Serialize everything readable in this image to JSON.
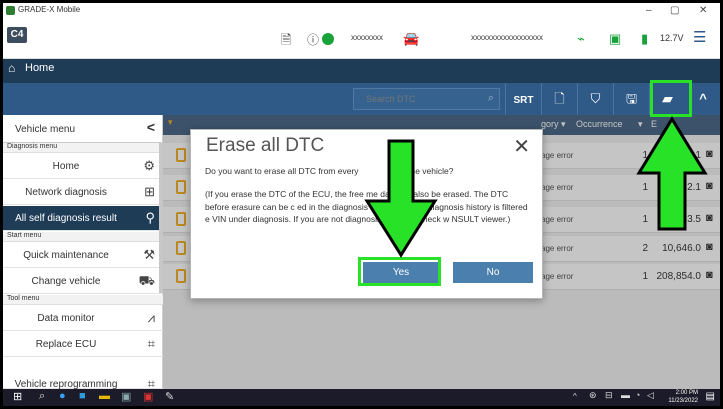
{
  "window": {
    "title": "GRADE-X Mobile",
    "minimize": "–",
    "maximize": "▢",
    "close": "✕"
  },
  "toolbar": {
    "logo": "C4",
    "masked_1": "xxxxxxxx",
    "masked_2": "xxxxxxxxxxxxxxxxxx",
    "voltage": "12.7V",
    "icons": [
      "page-icon",
      "power-status-icon",
      "car-icon",
      "signal-icon",
      "battery-icon",
      "hamburger-menu-icon"
    ]
  },
  "home": {
    "label": "Home"
  },
  "actions": {
    "search_placeholder": "Search DTC",
    "srt_label": "SRT"
  },
  "left_menu": {
    "title": "Vehicle menu",
    "sections": [
      {
        "header": "Diagnosis menu"
      },
      {
        "header": "Start menu"
      },
      {
        "header": "Tool menu"
      }
    ],
    "items": [
      {
        "label": "Home",
        "icon": "gear-icon"
      },
      {
        "label": "Network diagnosis",
        "icon": "network-icon"
      },
      {
        "label": "All self diagnosis result",
        "icon": "car-search-icon",
        "active": true
      },
      {
        "label": "Quick maintenance",
        "icon": "wrench-icon"
      },
      {
        "label": "Change vehicle",
        "icon": "car-icon"
      },
      {
        "label": "Data monitor",
        "icon": "monitor-icon"
      },
      {
        "label": "Replace ECU",
        "icon": "chip-icon"
      },
      {
        "label": "Vehicle reprogramming",
        "icon": "chip-icon"
      }
    ]
  },
  "table": {
    "headers": {
      "category": "gory",
      "occurrence": "Occurrence",
      "extra": "E"
    },
    "rows": [
      {
        "category": "age error",
        "occurrence": "1",
        "value": "2.1"
      },
      {
        "category": "age error",
        "occurrence": "1",
        "value": "2.1"
      },
      {
        "category": "age error",
        "occurrence": "1",
        "value": "3.5"
      },
      {
        "category": "age error",
        "occurrence": "2",
        "value": "10,646.0"
      },
      {
        "category": "age error",
        "occurrence": "1",
        "value": "208,854.0"
      }
    ]
  },
  "dialog": {
    "title": "Erase all DTC",
    "question": "Do you want to erase all DTC from every                on the vehicle?",
    "note": "(If you erase the DTC of the ECU, the free          me data will also be erased. The DTC before erasure can be c           ed in the diagnosis history, but the diagnosis history is filtered          e VIN under diagnosis. If you are not diagnosing, please check w            NSULT viewer.)",
    "yes": "Yes",
    "no": "No"
  },
  "taskbar": {
    "time": "2:00 PM",
    "date": "11/23/2022"
  },
  "colors": {
    "header_dark": "#1f3c57",
    "action_bar": "#2f5a87",
    "button_blue": "#4b7fad",
    "highlight_green": "#27e227",
    "warn_orange": "#f0a000"
  }
}
